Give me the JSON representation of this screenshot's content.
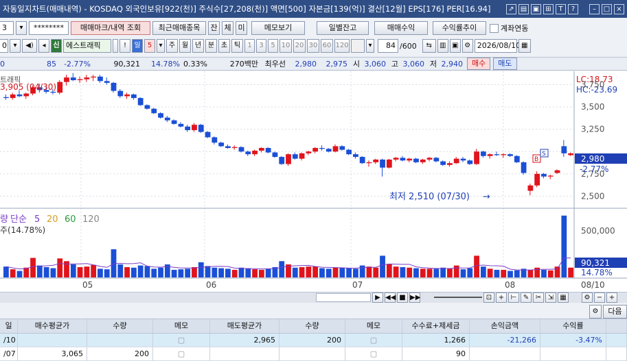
{
  "window": {
    "title": "자동일지차트(매매내역) - KOSDAQ 외국인보유[922(천)] 주식수[27,208(천)] 액면[500] 자본금[139(억)] 결산[12월] EPS[176] PER[16.94]",
    "icons": [
      "link-icon",
      "print-icon",
      "save-icon",
      "grid-icon",
      "text-icon",
      "help-icon",
      "minimize-icon",
      "maximize-icon",
      "close-icon"
    ]
  },
  "toolbar1": {
    "account_frag": "3",
    "password_mask": "********",
    "trade_mark_btn": "매매마크/내역 조회",
    "recent_btn": "최근매매종목",
    "jan_btn": "잔",
    "che_btn": "체",
    "mi_btn": "미",
    "memo_btn": "메모보기",
    "daily_balance_btn": "일별잔고",
    "trade_profit_btn": "매매수익",
    "yield_trend_btn": "수익률추이",
    "account_link_label": "계좌연동"
  },
  "toolbar2": {
    "stock_code_frag": "0",
    "stock_badge": "신",
    "stock_name": "에스트래픽",
    "period_badge": "일",
    "period_value": "5",
    "periods": [
      "주",
      "월",
      "년",
      "분",
      "초",
      "틱"
    ],
    "intervals": [
      "1",
      "3",
      "5",
      "10",
      "20",
      "30",
      "60",
      "120"
    ],
    "count_display": "84",
    "count_total": "/600",
    "date_value": "2026/08/10"
  },
  "quote": {
    "lead": "0",
    "change": "85",
    "change_pct": "-2.77%",
    "volume": "90,321",
    "vol_pct": "14.78%",
    "turnover": "0.33%",
    "amount": "270백만",
    "best_label": "최우선",
    "best_bid": "2,980",
    "best_ask": "2,975",
    "open_label": "시",
    "open": "3,060",
    "high_label": "고",
    "high": "3,060",
    "low_label": "저",
    "low": "2,940",
    "buy_btn": "매수",
    "sell_btn": "매도"
  },
  "chart": {
    "tab_label": "트래픽",
    "high_annot": "3,905 (04/30)",
    "low_annot": "최저 2,510 (07/30)",
    "lc_label": "LC:18.73",
    "hc_label": "HC:-23.69",
    "price_ticks": [
      "3,750",
      "3,500",
      "3,250",
      "2,750",
      "2,500"
    ],
    "current_price": "2,980",
    "current_change": "-2.77%",
    "vol_legend_prefix": "량",
    "vol_legend_ma": "단순",
    "vol_legend_periods": [
      "5",
      "20",
      "60",
      "120"
    ],
    "vol_ratio_text": "주(14.78%)",
    "vol_tick": "500,000",
    "vol_current": "90,321",
    "vol_current_pct": "14.78%",
    "x_labels": [
      "05",
      "06",
      "07",
      "08"
    ],
    "x_end": "08/10"
  },
  "chart_data": {
    "type": "candlestick",
    "ylim": [
      2380,
      3900
    ],
    "vol_max": 600000,
    "candles": [
      [
        3610,
        3640,
        3580,
        3600,
        100000
      ],
      [
        3600,
        3660,
        3580,
        3640,
        75000
      ],
      [
        3640,
        3690,
        3610,
        3620,
        60000
      ],
      [
        3620,
        3660,
        3590,
        3650,
        90000
      ],
      [
        3650,
        3740,
        3630,
        3720,
        180000
      ],
      [
        3720,
        3760,
        3660,
        3690,
        110000
      ],
      [
        3690,
        3720,
        3650,
        3670,
        95000
      ],
      [
        3670,
        3700,
        3640,
        3660,
        85000
      ],
      [
        3660,
        3800,
        3640,
        3780,
        175000
      ],
      [
        3780,
        3860,
        3740,
        3830,
        150000
      ],
      [
        3830,
        3880,
        3790,
        3800,
        120000
      ],
      [
        3800,
        3840,
        3770,
        3810,
        95000
      ],
      [
        3810,
        3860,
        3780,
        3830,
        100000
      ],
      [
        3830,
        3860,
        3790,
        3840,
        115000
      ],
      [
        3840,
        3860,
        3770,
        3790,
        80000
      ],
      [
        3790,
        3830,
        3750,
        3770,
        75000
      ],
      [
        3770,
        3780,
        3660,
        3680,
        260000
      ],
      [
        3680,
        3700,
        3600,
        3620,
        120000
      ],
      [
        3620,
        3660,
        3590,
        3640,
        95000
      ],
      [
        3640,
        3650,
        3580,
        3600,
        90000
      ],
      [
        3600,
        3610,
        3510,
        3520,
        110000
      ],
      [
        3520,
        3530,
        3470,
        3480,
        105000
      ],
      [
        3480,
        3490,
        3420,
        3430,
        80000
      ],
      [
        3430,
        3440,
        3370,
        3380,
        90000
      ],
      [
        3380,
        3400,
        3330,
        3350,
        120000
      ],
      [
        3350,
        3360,
        3300,
        3310,
        70000
      ],
      [
        3310,
        3330,
        3270,
        3280,
        75000
      ],
      [
        3280,
        3300,
        3220,
        3240,
        80000
      ],
      [
        3240,
        3320,
        3220,
        3300,
        95000
      ],
      [
        3300,
        3310,
        3210,
        3220,
        140000
      ],
      [
        3220,
        3230,
        3150,
        3160,
        105000
      ],
      [
        3160,
        3170,
        3080,
        3100,
        90000
      ],
      [
        3100,
        3110,
        3050,
        3060,
        85000
      ],
      [
        3060,
        3080,
        3030,
        3040,
        80000
      ],
      [
        3040,
        3070,
        3020,
        3050,
        70000
      ],
      [
        3050,
        3060,
        2990,
        3000,
        90000
      ],
      [
        3000,
        3010,
        2950,
        2970,
        85000
      ],
      [
        2970,
        3020,
        2950,
        3010,
        75000
      ],
      [
        3010,
        3050,
        2990,
        3040,
        70000
      ],
      [
        3040,
        3050,
        2980,
        2990,
        80000
      ],
      [
        2990,
        3000,
        2930,
        2940,
        95000
      ],
      [
        2940,
        2950,
        2850,
        2860,
        150000
      ],
      [
        2860,
        2980,
        2840,
        2970,
        120000
      ],
      [
        2970,
        2990,
        2910,
        2920,
        90000
      ],
      [
        2920,
        2990,
        2900,
        2980,
        95000
      ],
      [
        2980,
        3010,
        2960,
        3000,
        100000
      ],
      [
        3000,
        3050,
        2980,
        3040,
        100000
      ],
      [
        3040,
        3070,
        3010,
        3030,
        85000
      ],
      [
        3030,
        3040,
        2990,
        3000,
        80000
      ],
      [
        3000,
        3080,
        2990,
        3060,
        90000
      ],
      [
        3060,
        3070,
        3010,
        3020,
        90000
      ],
      [
        3020,
        3030,
        2960,
        2970,
        85000
      ],
      [
        2970,
        2990,
        2920,
        2940,
        80000
      ],
      [
        2940,
        2950,
        2860,
        2870,
        110000
      ],
      [
        2870,
        2900,
        2830,
        2880,
        100000
      ],
      [
        2880,
        2920,
        2860,
        2910,
        90000
      ],
      [
        2910,
        2920,
        2720,
        2820,
        200000
      ],
      [
        2820,
        2920,
        2810,
        2910,
        120000
      ],
      [
        2910,
        2940,
        2890,
        2930,
        100000
      ],
      [
        2930,
        2950,
        2890,
        2900,
        95000
      ],
      [
        2900,
        2930,
        2880,
        2920,
        90000
      ],
      [
        2920,
        2930,
        2870,
        2880,
        85000
      ],
      [
        2880,
        2920,
        2860,
        2910,
        80000
      ],
      [
        2910,
        2940,
        2890,
        2930,
        80000
      ],
      [
        2930,
        2940,
        2880,
        2890,
        80000
      ],
      [
        2890,
        2900,
        2840,
        2850,
        90000
      ],
      [
        2850,
        2890,
        2830,
        2870,
        80000
      ],
      [
        2870,
        2940,
        2860,
        2920,
        110000
      ],
      [
        2920,
        2940,
        2880,
        2900,
        75000
      ],
      [
        2900,
        2910,
        2850,
        2860,
        85000
      ],
      [
        2860,
        3030,
        2850,
        3000,
        200000
      ],
      [
        3000,
        3010,
        2930,
        2950,
        100000
      ],
      [
        2950,
        2980,
        2920,
        2970,
        80000
      ],
      [
        2970,
        3000,
        2950,
        2960,
        70000
      ],
      [
        2960,
        2980,
        2930,
        2970,
        70000
      ],
      [
        2970,
        2980,
        2940,
        2950,
        60000
      ],
      [
        2950,
        2960,
        2870,
        2880,
        65000
      ],
      [
        2880,
        2890,
        2740,
        2760,
        80000
      ],
      [
        2560,
        2640,
        2510,
        2620,
        70000
      ],
      [
        2620,
        2780,
        2600,
        2750,
        90000
      ],
      [
        2750,
        2760,
        2700,
        2720,
        70000
      ],
      [
        2720,
        2740,
        2690,
        2730,
        65000
      ],
      [
        2760,
        2800,
        2750,
        2790,
        100000
      ],
      [
        3060,
        3130,
        2940,
        2980,
        570000
      ],
      [
        2960,
        2990,
        2950,
        2980,
        90321
      ]
    ]
  },
  "table": {
    "headers": [
      "일",
      "매수평균가",
      "수량",
      "메모",
      "매도평균가",
      "수량",
      "메모",
      "수수료+제세금",
      "손익금액",
      "수익률"
    ],
    "rows": [
      {
        "date": "/10",
        "buy_avg": "",
        "buy_qty": "",
        "sell_avg": "2,965",
        "sell_qty": "200",
        "fee": "1,266",
        "pnl": "-21,266",
        "ret": "-3.47%"
      },
      {
        "date": "/07",
        "buy_avg": "3,065",
        "buy_qty": "200",
        "sell_avg": "",
        "sell_qty": "",
        "fee": "90",
        "pnl": "",
        "ret": ""
      }
    ],
    "next_btn": "다음"
  },
  "colors": {
    "up": "#e0141c",
    "down": "#1a4fd6",
    "title_bg": "#2f4e86",
    "accent_blue": "#1f3fb5"
  }
}
